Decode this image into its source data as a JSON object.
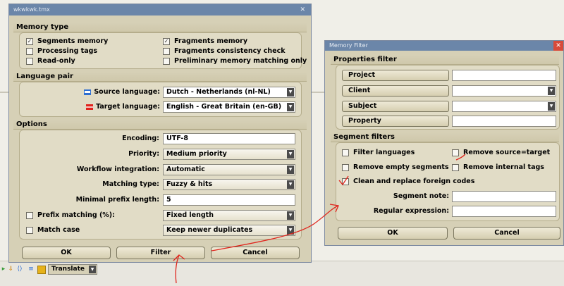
{
  "left_dialog": {
    "title": "wkwkwk.tmx",
    "sections": {
      "memory_type": "Memory type",
      "language_pair": "Language pair",
      "options": "Options"
    },
    "memory_type": {
      "segments_memory": "Segments memory",
      "processing_tags": "Processing tags",
      "read_only": "Read-only",
      "fragments_memory": "Fragments memory",
      "fragments_consistency_check": "Fragments consistency check",
      "preliminary_memory_matching_only": "Preliminary memory matching only"
    },
    "language_pair": {
      "source_label": "Source language:",
      "source_value": "Dutch - Netherlands (nl-NL)",
      "target_label": "Target language:",
      "target_value": "English - Great Britain (en-GB)"
    },
    "options": {
      "encoding_label": "Encoding:",
      "encoding_value": "UTF-8",
      "priority_label": "Priority:",
      "priority_value": "Medium priority",
      "workflow_label": "Workflow integration:",
      "workflow_value": "Automatic",
      "matching_label": "Matching type:",
      "matching_value": "Fuzzy & hits",
      "min_prefix_label": "Minimal prefix length:",
      "min_prefix_value": "5",
      "prefix_matching_label": "Prefix matching (%):",
      "prefix_matching_value": "Fixed length",
      "match_case_label": "Match case",
      "match_case_value": "Keep newer duplicates"
    },
    "buttons": {
      "ok": "OK",
      "filter": "Filter",
      "cancel": "Cancel"
    }
  },
  "filter_dialog": {
    "title": "Memory Filter",
    "properties_section": "Properties filter",
    "properties": [
      "Project",
      "Client",
      "Subject",
      "Property"
    ],
    "segment_section": "Segment filters",
    "filter_languages": "Filter languages",
    "remove_source_target": "Remove source=target",
    "remove_empty_segments": "Remove empty segments",
    "remove_internal_tags": "Remove internal tags",
    "clean_foreign_codes": "Clean and replace foreign codes",
    "segment_note_label": "Segment note:",
    "regular_expression_label": "Regular expression:",
    "buttons": {
      "ok": "OK",
      "cancel": "Cancel"
    }
  },
  "toolbar": {
    "mode_value": "Translate"
  },
  "colors": {
    "dialog_bg": "#d6d0b6",
    "titlebar": "#6b86a9",
    "annotation": "#e0241c"
  }
}
